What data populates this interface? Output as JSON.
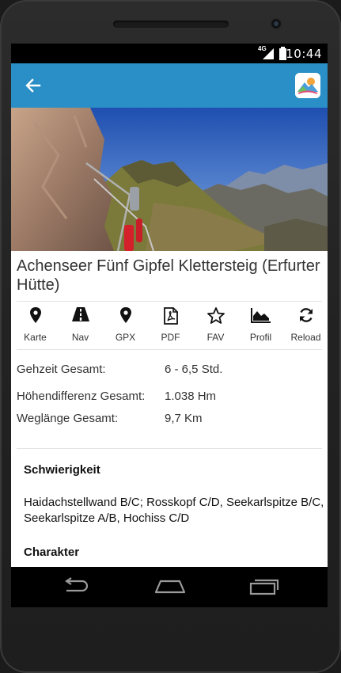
{
  "status_bar": {
    "network": "4G",
    "time": "10:44"
  },
  "colors": {
    "appbar": "#2a8fc6",
    "statusbar": "#000000",
    "navbar": "#000000"
  },
  "appbar": {
    "back_icon": "arrow-left-icon",
    "logo_icon": "app-logo-icon"
  },
  "hero": {
    "image": "climbing-ridge-photo"
  },
  "route": {
    "title": "Achenseer Fünf Gipfel Klettersteig (Erfurter Hütte)"
  },
  "actions": [
    {
      "label": "Karte",
      "icon": "map-pin-icon"
    },
    {
      "label": "Nav",
      "icon": "road-icon"
    },
    {
      "label": "GPX",
      "icon": "map-pin-icon"
    },
    {
      "label": "PDF",
      "icon": "pdf-file-icon"
    },
    {
      "label": "FAV",
      "icon": "star-icon"
    },
    {
      "label": "Profil",
      "icon": "area-chart-icon"
    },
    {
      "label": "Reload",
      "icon": "refresh-icon"
    }
  ],
  "stats": [
    {
      "label": "Gehzeit Gesamt:",
      "value": "6 - 6,5 Std."
    },
    {
      "label": "Höhendifferenz Gesamt:",
      "value": "1.038 Hm"
    },
    {
      "label": "Weglänge Gesamt:",
      "value": "9,7 Km"
    }
  ],
  "sections": {
    "difficulty": {
      "title": "Schwierigkeit",
      "text": "Haidachstellwand B/C; Rosskopf C/D, Seekarlspitze B/C, Seekarlspitze A/B, Hochiss C/D"
    },
    "character": {
      "title": "Charakter"
    }
  },
  "navbar": {
    "back": "nav-back-icon",
    "home": "nav-home-icon",
    "recents": "nav-recents-icon"
  }
}
